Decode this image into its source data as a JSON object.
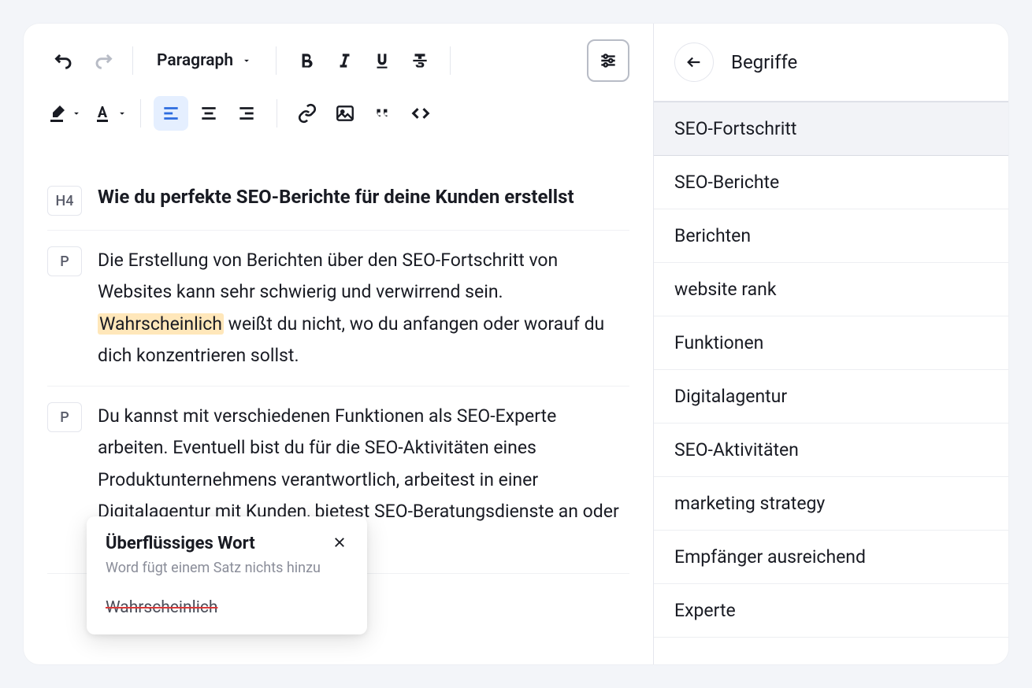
{
  "toolbar": {
    "paragraph_label": "Paragraph"
  },
  "blocks": [
    {
      "tag": "H4",
      "heading": true,
      "text": "Wie du perfekte SEO-Berichte für deine Kunden erstellst"
    },
    {
      "tag": "P",
      "heading": false,
      "pre": "Die Erstellung von Berichten über den SEO-Fortschritt von Websites kann sehr schwierig und verwirrend sein. ",
      "highlight": "Wahrscheinlich",
      "post": " weißt du nicht, wo du anfangen oder worauf du dich konzentrieren sollst."
    },
    {
      "tag": "P",
      "heading": false,
      "text": "Du kannst mit verschiedenen Funktionen als SEO-Experte arbeiten. Eventuell bist du für die SEO-Aktivitäten eines Produktunternehmens verantwortlich, arbeitest in einer Digitalagentur mit Kunden, bietest SEO-Beratungsdienste an oder betreibst"
    }
  ],
  "popover": {
    "title": "Überflüssiges Wort",
    "subtitle": "Word fügt einem Satz nichts hinzu",
    "strike": "Wahrscheinlich"
  },
  "sidebar": {
    "title": "Begriffe",
    "terms": [
      "SEO-Fortschritt",
      "SEO-Berichte",
      "Berichten",
      "website rank",
      "Funktionen",
      "Digitalagentur",
      "SEO-Aktivitäten",
      "marketing strategy",
      "Empfänger ausreichend",
      "Experte"
    ],
    "selected_index": 0
  }
}
